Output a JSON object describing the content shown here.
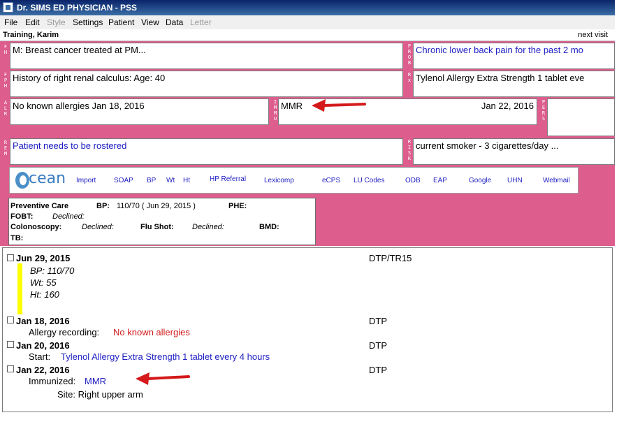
{
  "window": {
    "title": "Dr. SIMS ED PHYSICIAN - PSS"
  },
  "menu": [
    {
      "label": "File",
      "enabled": true
    },
    {
      "label": "Edit",
      "enabled": true
    },
    {
      "label": "Style",
      "enabled": false
    },
    {
      "label": "Settings",
      "enabled": true
    },
    {
      "label": "Patient",
      "enabled": true
    },
    {
      "label": "View",
      "enabled": true
    },
    {
      "label": "Data",
      "enabled": true
    },
    {
      "label": "Letter",
      "enabled": false
    }
  ],
  "patient": {
    "name": "Training, Karim",
    "next_visit": "next visit"
  },
  "fields": {
    "fh": {
      "label": "FH",
      "value": "M: Breast cancer treated at PM..."
    },
    "prob": {
      "label": "PROB",
      "value": "Chronic lower back pain for the past 2 mo"
    },
    "fph": {
      "label": "FPH",
      "value": "History of right renal calculus: Age: 40"
    },
    "rx": {
      "label": "Rx",
      "value": "Tylenol Allergy Extra Strength 1 tablet eve"
    },
    "alr": {
      "label": "ALR",
      "value": "No known allergies Jan 18, 2016"
    },
    "immu": {
      "label": "IMMU",
      "value": "MMR",
      "date": "Jan 22, 2016"
    },
    "pers": {
      "label": "PERS",
      "value": ""
    },
    "rem": {
      "label": "REM",
      "value": "Patient needs to be rostered"
    },
    "risk": {
      "label": "RISK",
      "value": "current smoker - 3 cigarettes/day ..."
    }
  },
  "toolbar": {
    "logo": "cean",
    "links": [
      "Import",
      "SOAP",
      "BP",
      "Wt",
      "Ht",
      "HP Referral",
      "Lexicomp",
      "eCPS",
      "LU Codes",
      "ODB",
      "EAP",
      "Google",
      "UHN",
      "Webmail"
    ]
  },
  "preventive": {
    "title": "Preventive Care",
    "bp_label": "BP:",
    "bp_value": "110/70 ( Jun 29, 2015 )",
    "phe_label": "PHE:",
    "fobt_label": "FOBT:",
    "fobt_value": "Declined:",
    "colonoscopy_label": "Colonoscopy:",
    "colonoscopy_value": "Declined:",
    "flushot_label": "Flu Shot:",
    "flushot_value": "Declined:",
    "bmd_label": "BMD:",
    "tb_label": "TB:"
  },
  "encounters": [
    {
      "date": "Jun 29, 2015",
      "type": "DTP/TR15",
      "lines": [
        {
          "text": "BP: 110/70"
        },
        {
          "text": "Wt: 55"
        },
        {
          "text": "Ht: 160"
        }
      ]
    },
    {
      "date": "Jan 18, 2016",
      "type": "DTP",
      "lines": [
        {
          "label": "Allergy recording:",
          "value": "No known allergies"
        }
      ]
    },
    {
      "date": "Jan 20, 2016",
      "type": "DTP",
      "lines": [
        {
          "label": "Start:",
          "value": "Tylenol Allergy Extra Strength 1 tablet every 4 hours"
        }
      ]
    },
    {
      "date": "Jan 22, 2016",
      "type": "DTP",
      "lines": [
        {
          "label": "Immunized:",
          "value": "MMR"
        },
        {
          "text": "Site: Right upper arm"
        }
      ]
    }
  ],
  "colors": {
    "panel_pink": "#dd5d8d",
    "link_blue": "#1d1dc2",
    "alert_red": "#d41a1a",
    "highlight_yellow": "#ffff00"
  },
  "icons": [
    "app-icon",
    "arrow-icon",
    "checkbox-icon"
  ]
}
